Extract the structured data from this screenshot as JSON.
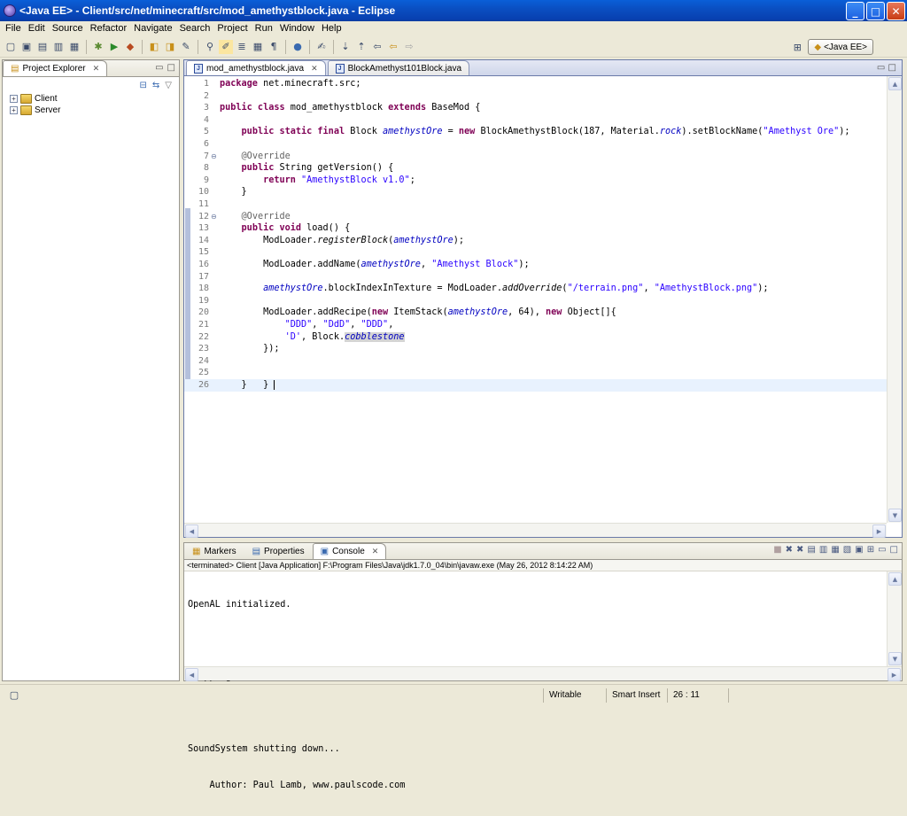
{
  "window": {
    "title": "<Java EE> - Client/src/net/minecraft/src/mod_amethystblock.java - Eclipse",
    "minimize": "_",
    "maximize": "□",
    "close": "✕"
  },
  "menu": [
    "File",
    "Edit",
    "Source",
    "Refactor",
    "Navigate",
    "Search",
    "Project",
    "Run",
    "Window",
    "Help"
  ],
  "perspective": {
    "label": "<Java EE>"
  },
  "explorer": {
    "tab_label": "Project Explorer",
    "projects": [
      "Client",
      "Server"
    ]
  },
  "editor": {
    "tabs": [
      {
        "label": "mod_amethystblock.java",
        "active": true
      },
      {
        "label": "BlockAmethyst101Block.java",
        "active": false
      }
    ],
    "current_line": 26
  },
  "bottom_panel": {
    "tabs": [
      "Markers",
      "Properties",
      "Console"
    ],
    "console_info": "<terminated> Client [Java Application] F:\\Program Files\\Java\\jdk1.7.0_04\\bin\\javaw.exe (May 26, 2012 8:14:22 AM)",
    "output": [
      "OpenAL initialized.",
      "",
      "Stopping!",
      "",
      "SoundSystem shutting down...",
      "    Author: Paul Lamb, www.paulscode.com"
    ]
  },
  "statusbar": {
    "writable": "Writable",
    "insert_mode": "Smart Insert",
    "position": "26 : 11"
  },
  "colors": {
    "keyword": "#7f0055",
    "string": "#2a00ff",
    "field": "#0000c0",
    "annotation": "#646464",
    "titlebar": "#0a4fc2"
  }
}
